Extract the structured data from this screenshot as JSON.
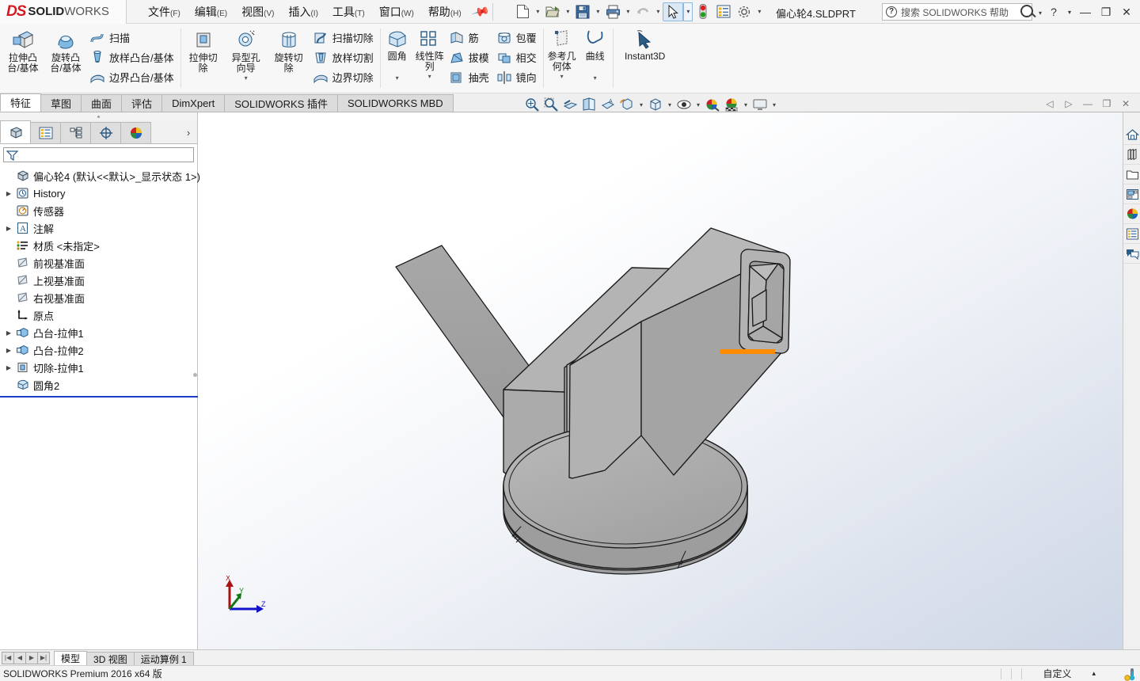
{
  "app": {
    "brand_ds": "DS",
    "brand_solid": "SOLID",
    "brand_works": "WORKS",
    "document_title": "偏心轮4.SLDPRT",
    "version_text": "SOLIDWORKS Premium 2016 x64 版",
    "accent_color": "#d61920",
    "highlight_edge_color": "#ff8c00"
  },
  "menu": {
    "items": [
      {
        "label": "文件",
        "mnemonic": "(F)"
      },
      {
        "label": "编辑",
        "mnemonic": "(E)"
      },
      {
        "label": "视图",
        "mnemonic": "(V)"
      },
      {
        "label": "插入",
        "mnemonic": "(I)"
      },
      {
        "label": "工具",
        "mnemonic": "(T)"
      },
      {
        "label": "窗口",
        "mnemonic": "(W)"
      },
      {
        "label": "帮助",
        "mnemonic": "(H)"
      }
    ],
    "pin_icon": "pushpin-icon"
  },
  "quick_access": {
    "buttons": [
      {
        "name": "new-document-button",
        "icon": "new-file-icon",
        "has_caret": true
      },
      {
        "name": "open-document-button",
        "icon": "open-folder-icon",
        "has_caret": true
      },
      {
        "name": "save-button",
        "icon": "floppy-save-icon",
        "has_caret": true
      },
      {
        "name": "print-button",
        "icon": "printer-icon",
        "has_caret": true
      },
      {
        "name": "undo-button",
        "icon": "undo-arrow-icon",
        "has_caret": true
      },
      {
        "name": "select-button",
        "icon": "cursor-arrow-icon",
        "has_caret": true,
        "selected": true
      },
      {
        "name": "rebuild-button",
        "icon": "traffic-light-icon",
        "has_caret": false
      },
      {
        "name": "file-properties-button",
        "icon": "properties-list-icon",
        "has_caret": false
      },
      {
        "name": "options-button",
        "icon": "gear-icon",
        "has_caret": true
      }
    ]
  },
  "help_search": {
    "placeholder": "搜索 SOLIDWORKS 帮助",
    "question_mark": "?"
  },
  "window_controls": {
    "help": "?",
    "help_caret": "▾",
    "minimize": "—",
    "restore": "❐",
    "close": "✕"
  },
  "ribbon": {
    "groups": [
      {
        "name": "boss-group",
        "big": [
          {
            "label": "拉伸凸\n台/基体",
            "icon": "extruded-boss-icon",
            "name": "extruded-boss-button"
          },
          {
            "label": "旋转凸\n台/基体",
            "icon": "revolved-boss-icon",
            "name": "revolved-boss-button"
          }
        ],
        "small": [
          {
            "label": "扫描",
            "icon": "swept-boss-icon",
            "name": "swept-boss-button"
          },
          {
            "label": "放样凸台/基体",
            "icon": "lofted-boss-icon",
            "name": "lofted-boss-button"
          },
          {
            "label": "边界凸台/基体",
            "icon": "boundary-boss-icon",
            "name": "boundary-boss-button"
          }
        ]
      },
      {
        "name": "cut-group",
        "big": [
          {
            "label": "拉伸切\n除",
            "icon": "extruded-cut-icon",
            "name": "extruded-cut-button"
          },
          {
            "label": "异型孔\n向导",
            "icon": "hole-wizard-icon",
            "name": "hole-wizard-button",
            "caret": true
          },
          {
            "label": "旋转切\n除",
            "icon": "revolved-cut-icon",
            "name": "revolved-cut-button"
          }
        ],
        "small": [
          {
            "label": "扫描切除",
            "icon": "swept-cut-icon",
            "name": "swept-cut-button"
          },
          {
            "label": "放样切割",
            "icon": "lofted-cut-icon",
            "name": "lofted-cut-button"
          },
          {
            "label": "边界切除",
            "icon": "boundary-cut-icon",
            "name": "boundary-cut-button"
          }
        ]
      },
      {
        "name": "feature-group",
        "big": [
          {
            "label": "圆角",
            "icon": "fillet-icon",
            "name": "fillet-button",
            "caret": true
          },
          {
            "label": "线性阵\n列",
            "icon": "linear-pattern-icon",
            "name": "linear-pattern-button",
            "caret": true
          }
        ],
        "small": [
          {
            "label": "筋",
            "icon": "rib-icon",
            "name": "rib-button"
          },
          {
            "label": "拔模",
            "icon": "draft-icon",
            "name": "draft-button"
          },
          {
            "label": "抽壳",
            "icon": "shell-icon",
            "name": "shell-button"
          }
        ],
        "small2": [
          {
            "label": "包覆",
            "icon": "wrap-icon",
            "name": "wrap-button"
          },
          {
            "label": "相交",
            "icon": "intersect-icon",
            "name": "intersect-button"
          },
          {
            "label": "镜向",
            "icon": "mirror-icon",
            "name": "mirror-button"
          }
        ]
      },
      {
        "name": "reference-group",
        "big": [
          {
            "label": "参考几\n何体",
            "icon": "reference-geometry-icon",
            "name": "reference-geometry-button",
            "caret": true
          },
          {
            "label": "曲线",
            "icon": "curves-icon",
            "name": "curves-button",
            "caret": true
          }
        ]
      },
      {
        "name": "instant3d-group",
        "big": [
          {
            "label": "Instant3D",
            "icon": "instant3d-icon",
            "name": "instant3d-button",
            "wide": true
          }
        ]
      }
    ]
  },
  "command_tabs": {
    "items": [
      {
        "label": "特征",
        "active": true
      },
      {
        "label": "草图",
        "active": false
      },
      {
        "label": "曲面",
        "active": false
      },
      {
        "label": "评估",
        "active": false
      },
      {
        "label": "DimXpert",
        "active": false
      },
      {
        "label": "SOLIDWORKS 插件",
        "active": false
      },
      {
        "label": "SOLIDWORKS MBD",
        "active": false
      }
    ]
  },
  "view_toolbar": {
    "buttons": [
      {
        "name": "zoom-to-fit-button",
        "icon": "zoom-to-fit-icon",
        "caret": false
      },
      {
        "name": "zoom-to-area-button",
        "icon": "zoom-area-icon",
        "caret": false
      },
      {
        "name": "section-view-button",
        "icon": "section-view-icon",
        "caret": false
      },
      {
        "name": "view-orientation-button",
        "icon": "view-orientation-icon",
        "caret": false
      },
      {
        "name": "zoom-selection-button",
        "icon": "zoom-selection-icon",
        "caret": false
      },
      {
        "name": "rotate-view-button",
        "icon": "rotate-view-icon",
        "caret": true
      },
      {
        "name": "display-style-button",
        "icon": "display-style-icon",
        "caret": true
      },
      {
        "name": "hide-show-items-button",
        "icon": "hide-show-icon",
        "caret": true
      },
      {
        "name": "edit-appearance-button",
        "icon": "edit-appearance-icon",
        "caret": false
      },
      {
        "name": "apply-scene-button",
        "icon": "apply-scene-icon",
        "caret": true
      },
      {
        "name": "view-settings-button",
        "icon": "monitor-icon",
        "caret": true
      }
    ]
  },
  "doc_window_controls": {
    "buttons": [
      {
        "name": "prev-doc-button",
        "glyph": "◁"
      },
      {
        "name": "next-doc-button",
        "glyph": "▷"
      },
      {
        "name": "doc-minimize-button",
        "glyph": "—"
      },
      {
        "name": "doc-restore-button",
        "glyph": "❐"
      },
      {
        "name": "doc-close-button",
        "glyph": "✕"
      }
    ]
  },
  "feature_manager": {
    "tabs": [
      {
        "name": "feature-manager-tab",
        "icon": "feature-tree-icon",
        "active": true
      },
      {
        "name": "property-manager-tab",
        "icon": "property-list-icon",
        "active": false
      },
      {
        "name": "configuration-manager-tab",
        "icon": "configuration-icon",
        "active": false
      },
      {
        "name": "dimxpert-manager-tab",
        "icon": "dimxpert-target-icon",
        "active": false
      },
      {
        "name": "display-manager-tab",
        "icon": "display-sphere-icon",
        "active": false
      }
    ],
    "more_glyph": "›",
    "filter": {
      "placeholder": "",
      "value": "",
      "icon": "filter-funnel-icon"
    },
    "root": {
      "label": "偏心轮4  (默认<<默认>_显示状态 1>)",
      "icon": "part-icon"
    },
    "nodes": [
      {
        "label": "History",
        "icon": "history-icon",
        "expandable": true,
        "indent": 0
      },
      {
        "label": "传感器",
        "icon": "sensor-icon",
        "expandable": false,
        "indent": 0
      },
      {
        "label": "注解",
        "icon": "annotations-icon",
        "expandable": true,
        "indent": 0
      },
      {
        "label": "材质 <未指定>",
        "icon": "material-icon",
        "expandable": false,
        "indent": 0
      },
      {
        "label": "前视基准面",
        "icon": "plane-icon",
        "expandable": false,
        "indent": 0
      },
      {
        "label": "上视基准面",
        "icon": "plane-icon",
        "expandable": false,
        "indent": 0
      },
      {
        "label": "右视基准面",
        "icon": "plane-icon",
        "expandable": false,
        "indent": 0
      },
      {
        "label": "原点",
        "icon": "origin-icon",
        "expandable": false,
        "indent": 0
      },
      {
        "label": "凸台-拉伸1",
        "icon": "boss-extrude-icon",
        "expandable": true,
        "indent": 0
      },
      {
        "label": "凸台-拉伸2",
        "icon": "boss-extrude-icon",
        "expandable": true,
        "indent": 0
      },
      {
        "label": "切除-拉伸1",
        "icon": "cut-extrude-icon",
        "expandable": true,
        "indent": 0
      },
      {
        "label": "圆角2",
        "icon": "fillet-feature-icon",
        "expandable": false,
        "indent": 0
      }
    ]
  },
  "right_task_pane": {
    "buttons": [
      {
        "name": "solidworks-resources-button",
        "icon": "home-icon"
      },
      {
        "name": "design-library-button",
        "icon": "books-icon"
      },
      {
        "name": "file-explorer-button",
        "icon": "folder-icon"
      },
      {
        "name": "view-palette-button",
        "icon": "view-palette-icon"
      },
      {
        "name": "appearances-scenes-button",
        "icon": "appearance-sphere-icon"
      },
      {
        "name": "custom-properties-button",
        "icon": "custom-properties-icon"
      },
      {
        "name": "solidworks-forum-button",
        "icon": "forum-bubble-icon"
      }
    ]
  },
  "triad": {
    "x_label": "X",
    "y_label": "Y",
    "z_label": "Z",
    "x_color": "#aa1111",
    "y_color": "#117711",
    "z_color": "#1111cc"
  },
  "bottom_tabs": {
    "nav": [
      {
        "name": "first-tab-button",
        "glyph": "|◀"
      },
      {
        "name": "prev-tab-button",
        "glyph": "◀"
      },
      {
        "name": "next-tab-button",
        "glyph": "▶"
      },
      {
        "name": "last-tab-button",
        "glyph": "▶|"
      }
    ],
    "items": [
      {
        "label": "模型",
        "active": true
      },
      {
        "label": "3D 视图",
        "active": false
      },
      {
        "label": "运动算例 1",
        "active": false
      }
    ]
  },
  "status_bar": {
    "left_text": "SOLIDWORKS Premium 2016 x64 版",
    "custom_label": "自定义",
    "custom_caret": "▴",
    "thermometer_icon": "thermometer-icon"
  },
  "model": {
    "description": "偏心轮 (eccentric cam bracket) shaded solid with edges",
    "face_color": "#a9a9a9",
    "edge_color": "#1a1a1a",
    "selected_edge_color": "#ff8c00"
  }
}
